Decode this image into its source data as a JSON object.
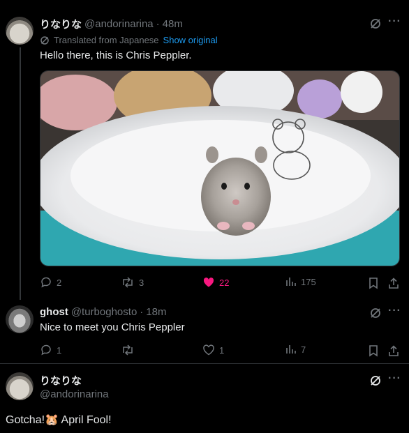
{
  "tweet1": {
    "display_name": "りなりな",
    "handle": "@andorinarina",
    "time": "48m",
    "translated_label": "Translated from Japanese",
    "show_original": "Show original",
    "text": "Hello there, this is Chris Peppler.",
    "stats": {
      "replies": "2",
      "reposts": "3",
      "likes": "22",
      "views": "175"
    }
  },
  "tweet2": {
    "display_name": "ghost",
    "handle": "@turboghosto",
    "time": "18m",
    "text": "Nice to meet you Chris Peppler",
    "stats": {
      "replies": "1",
      "reposts": "",
      "likes": "1",
      "views": "7"
    }
  },
  "tweet3": {
    "display_name": "りなりな",
    "handle": "@andorinarina",
    "text_before": "Gotcha!",
    "emoji": "🐹",
    "text_after": " April Fool!"
  },
  "colors": {
    "accent": "#1d9bf0",
    "like": "#f91880",
    "muted": "#71767b"
  }
}
